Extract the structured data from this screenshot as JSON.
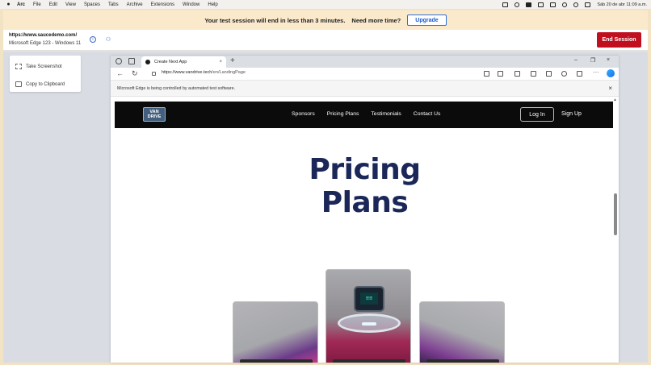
{
  "menubar": {
    "app_name": "Arc",
    "items": [
      "File",
      "Edit",
      "View",
      "Spaces",
      "Tabs",
      "Archive",
      "Extensions",
      "Window",
      "Help"
    ],
    "datetime": "Sáb 20 de abr  11:09 a.m."
  },
  "banner": {
    "message": "Your test session will end in less than 3 minutes.",
    "question": "Need more time?",
    "upgrade_label": "Upgrade"
  },
  "session": {
    "url": "https://www.saucedemo.com/",
    "environment": "Microsoft Edge 123 - Windows 11",
    "info_glyph": "i",
    "end_label": "End Session"
  },
  "tools": {
    "screenshot_label": "Take Screenshot",
    "clipboard_label": "Copy to Clipboard"
  },
  "browser": {
    "tab_title": "Create Next App",
    "tab_close": "×",
    "new_tab": "+",
    "address_prefix": "https://www.vandrive.tech",
    "address_path": "/en/LandingPage",
    "infobar_text": "Microsoft Edge is being controlled by automated test software.",
    "infobar_close": "×",
    "window_controls": [
      "–",
      "❐",
      "×"
    ],
    "more": "···"
  },
  "site": {
    "logo_line1": "VAN",
    "logo_line2": "DRIVE",
    "nav": [
      "Sponsors",
      "Pricing Plans",
      "Testimonials",
      "Contact Us"
    ],
    "login": "Log In",
    "signup": "Sign Up",
    "hero_line1": "Pricing",
    "hero_line2": "Plans",
    "device_screen": "≡≡"
  },
  "colors": {
    "banner_bg": "#fbe9cc",
    "end_session": "#c0101f",
    "hero_text": "#1a2758",
    "upgrade_accent": "#1b5bc9"
  }
}
